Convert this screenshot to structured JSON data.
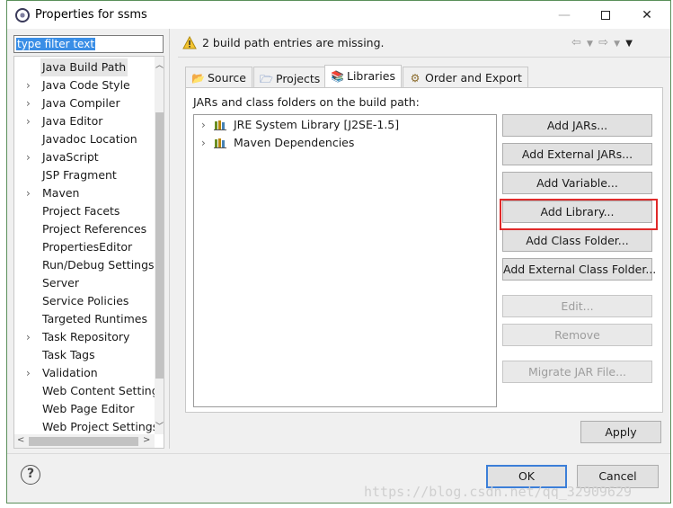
{
  "window": {
    "title": "Properties for ssms"
  },
  "window_controls": {
    "minimize": "—",
    "close": "✕"
  },
  "filter": {
    "value": "type filter text"
  },
  "tree": {
    "items": [
      {
        "label": "Java Build Path",
        "expandable": false,
        "selected": true
      },
      {
        "label": "Java Code Style",
        "expandable": true
      },
      {
        "label": "Java Compiler",
        "expandable": true
      },
      {
        "label": "Java Editor",
        "expandable": true
      },
      {
        "label": "Javadoc Location",
        "expandable": false
      },
      {
        "label": "JavaScript",
        "expandable": true
      },
      {
        "label": "JSP Fragment",
        "expandable": false
      },
      {
        "label": "Maven",
        "expandable": true
      },
      {
        "label": "Project Facets",
        "expandable": false
      },
      {
        "label": "Project References",
        "expandable": false
      },
      {
        "label": "PropertiesEditor",
        "expandable": false
      },
      {
        "label": "Run/Debug Settings",
        "expandable": false
      },
      {
        "label": "Server",
        "expandable": false
      },
      {
        "label": "Service Policies",
        "expandable": false
      },
      {
        "label": "Targeted Runtimes",
        "expandable": false
      },
      {
        "label": "Task Repository",
        "expandable": true
      },
      {
        "label": "Task Tags",
        "expandable": false
      },
      {
        "label": "Validation",
        "expandable": true
      },
      {
        "label": "Web Content Settings",
        "expandable": false
      },
      {
        "label": "Web Page Editor",
        "expandable": false
      },
      {
        "label": "Web Project Settings",
        "expandable": false
      }
    ]
  },
  "header": {
    "message": "2 build path entries are missing."
  },
  "tabs": [
    {
      "label": "Source",
      "icon": "source-folder-icon"
    },
    {
      "label": "Projects",
      "icon": "projects-icon"
    },
    {
      "label": "Libraries",
      "icon": "libraries-icon",
      "active": true
    },
    {
      "label": "Order and Export",
      "icon": "order-export-icon"
    }
  ],
  "libraries": {
    "label": "JARs and class folders on the build path:",
    "entries": [
      {
        "label": "JRE System Library [J2SE-1.5]"
      },
      {
        "label": "Maven Dependencies"
      }
    ]
  },
  "buttons": {
    "add_jars": "Add JARs...",
    "add_external_jars": "Add External JARs...",
    "add_variable": "Add Variable...",
    "add_library": "Add Library...",
    "add_class_folder": "Add Class Folder...",
    "add_external_class_folder": "Add External Class Folder...",
    "edit": "Edit...",
    "remove": "Remove",
    "migrate_jar": "Migrate JAR File...",
    "apply": "Apply",
    "ok": "OK",
    "cancel": "Cancel"
  },
  "help": {
    "symbol": "?"
  },
  "watermark": {
    "text": "https://blog.csdn.net/qq_32909629"
  },
  "colors": {
    "highlight": "#e02a2a",
    "default_button_border": "#3c7fd8",
    "filter_selection": "#3a8ee6"
  }
}
